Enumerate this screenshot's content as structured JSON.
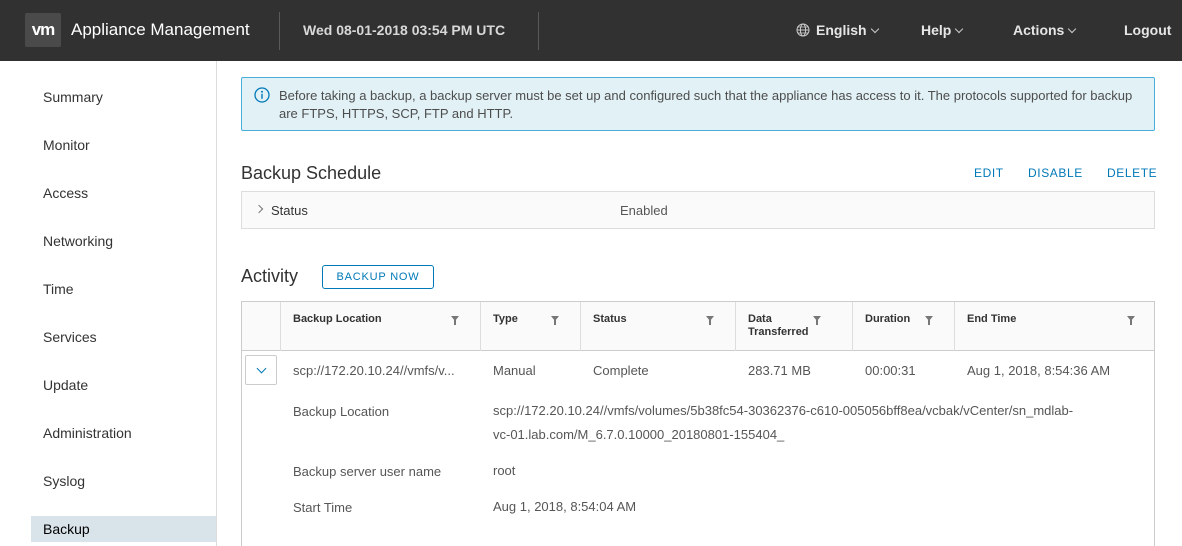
{
  "header": {
    "logo_text": "vm",
    "app_title": "Appliance Management",
    "datetime": "Wed 08-01-2018 03:54 PM UTC",
    "menus": {
      "language": "English",
      "help": "Help",
      "actions": "Actions",
      "logout": "Logout"
    },
    "background_color": "#313131"
  },
  "sidebar": {
    "items": [
      {
        "label": "Summary"
      },
      {
        "label": "Monitor"
      },
      {
        "label": "Access"
      },
      {
        "label": "Networking"
      },
      {
        "label": "Time"
      },
      {
        "label": "Services"
      },
      {
        "label": "Update"
      },
      {
        "label": "Administration"
      },
      {
        "label": "Syslog"
      },
      {
        "label": "Backup"
      }
    ],
    "active_item": "Backup"
  },
  "alert": {
    "text": "Before taking a backup, a backup server must be set up and configured such that the appliance has access to it. The protocols supported for backup are FTPS, HTTPS, SCP, FTP and HTTP.",
    "icon": "info-circle-icon"
  },
  "schedule": {
    "title": "Backup Schedule",
    "edit_label": "EDIT",
    "disable_label": "DISABLE",
    "delete_label": "DELETE",
    "status_label": "Status",
    "status_value": "Enabled"
  },
  "activity": {
    "title": "Activity",
    "backup_now_label": "BACKUP NOW",
    "columns": {
      "location": "Backup Location",
      "type": "Type",
      "status": "Status",
      "data_line1": "Data",
      "data_line2": "Transferred",
      "duration": "Duration",
      "end_time": "End Time"
    },
    "row": {
      "location": "scp://172.20.10.24//vmfs/v...",
      "type": "Manual",
      "status": "Complete",
      "data": "283.71 MB",
      "duration": "00:00:31",
      "end_time": "Aug 1, 2018, 8:54:36 AM"
    },
    "details": {
      "location_label": "Backup Location",
      "location_line1": "scp://172.20.10.24//vmfs/volumes/5b38fc54-30362376-c610-005056bff8ea/vcbak/vCenter/sn_mdlab-",
      "location_line2": "vc-01.lab.com/M_6.7.0.10000_20180801-155404_",
      "user_label": "Backup server user name",
      "user_value": "root",
      "start_label": "Start Time",
      "start_value": "Aug 1, 2018, 8:54:04 AM"
    }
  },
  "colors": {
    "accent": "#0079b8",
    "alert_bg": "#e1f1f6",
    "alert_border": "#49afd9",
    "active_nav": "#d9e4ea"
  }
}
